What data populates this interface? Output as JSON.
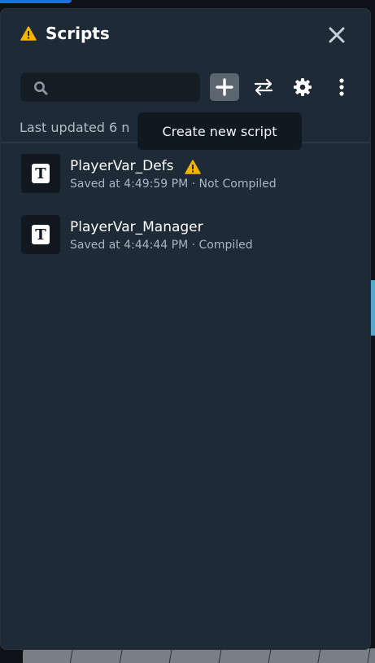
{
  "panel": {
    "title": "Scripts",
    "close_label": "×"
  },
  "toolbar": {
    "search_placeholder": "",
    "search_value": "",
    "add_tooltip": "Create new script"
  },
  "status": {
    "last_updated": "Last updated 6 n"
  },
  "scripts": [
    {
      "name": "PlayerVar_Defs",
      "saved": "Saved at 4:49:59 PM · Not Compiled",
      "icon_letter": "T",
      "has_warning": true
    },
    {
      "name": "PlayerVar_Manager",
      "saved": "Saved at 4:44:44 PM · Compiled",
      "icon_letter": "T",
      "has_warning": false
    }
  ],
  "colors": {
    "panel_bg": "#1e2a35",
    "warning": "#f5b400",
    "text_primary": "#ffffff",
    "text_secondary": "#aab5bf",
    "accent_blue": "#1d6fe0"
  },
  "icons": [
    "warning-icon",
    "close-icon",
    "search-icon",
    "plus-icon",
    "swap-icon",
    "gear-icon",
    "more-vertical-icon",
    "script-file-icon"
  ]
}
